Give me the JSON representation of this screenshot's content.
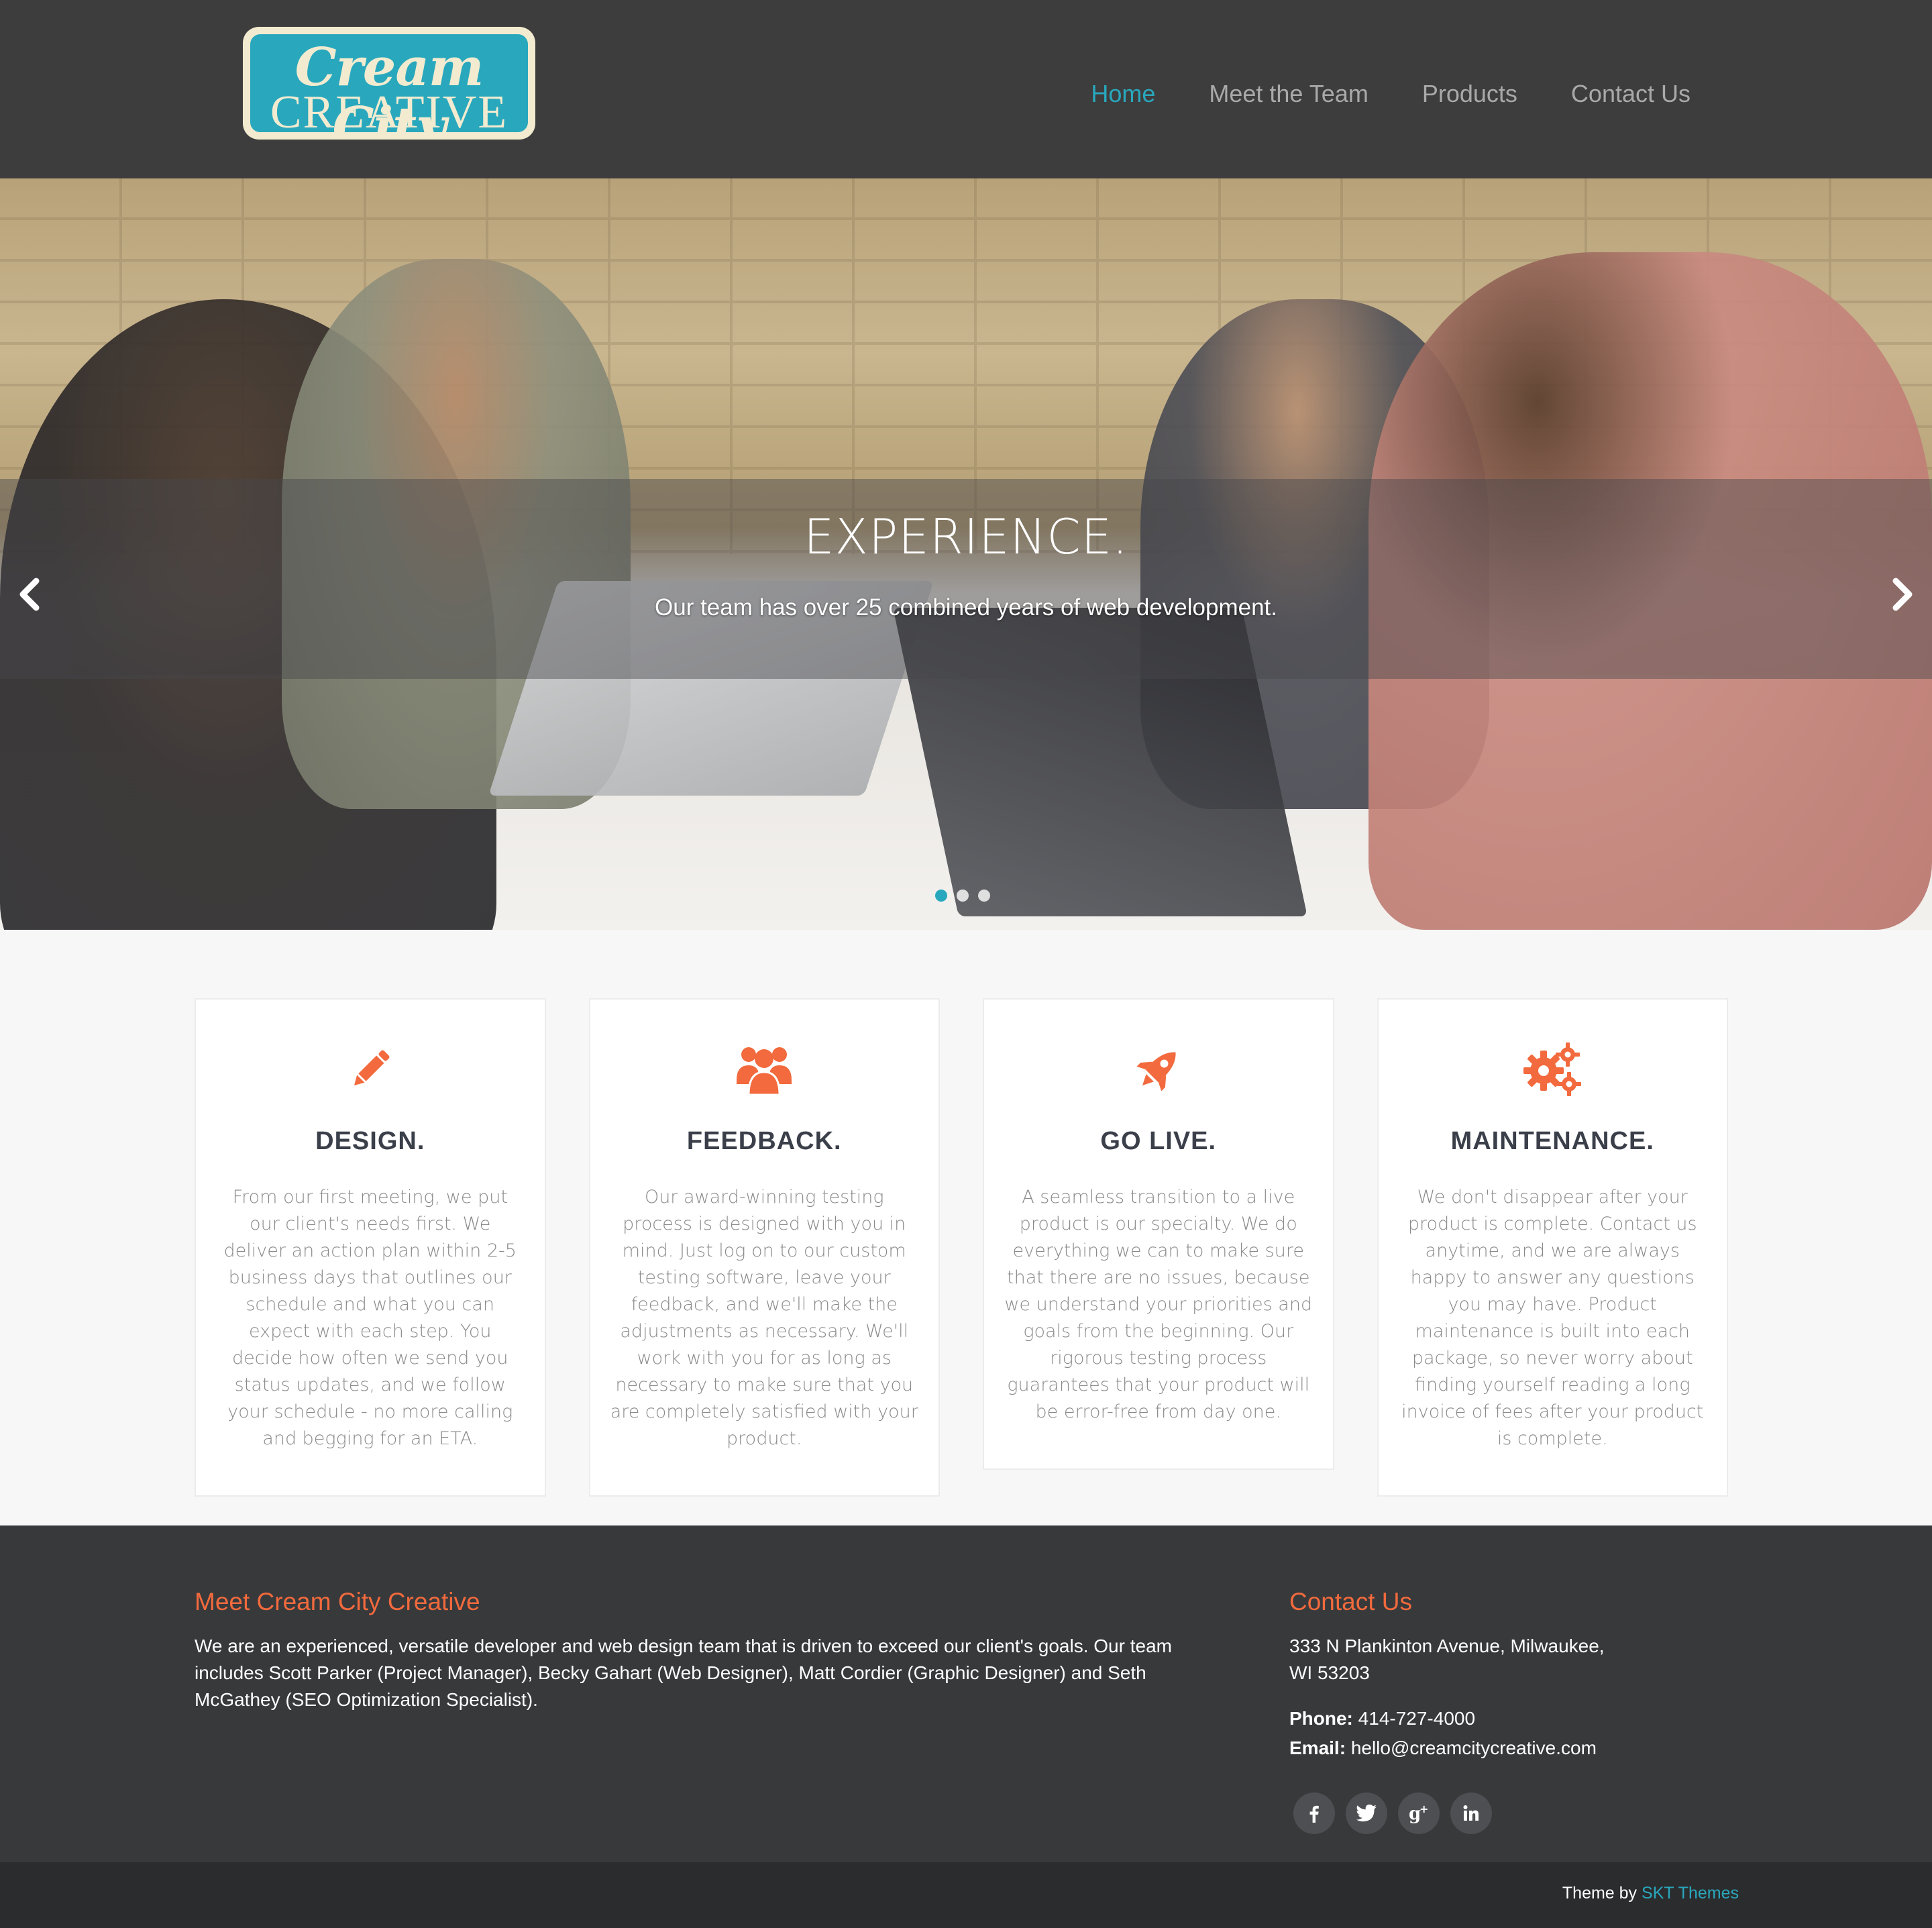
{
  "header": {
    "logo": {
      "line1": "Cream City",
      "line2": "CREATIVE"
    },
    "nav": [
      {
        "label": "Home",
        "active": true
      },
      {
        "label": "Meet the Team",
        "active": false
      },
      {
        "label": "Products",
        "active": false
      },
      {
        "label": "Contact Us",
        "active": false
      }
    ]
  },
  "hero": {
    "title": "EXPERIENCE.",
    "subtitle": "Our team has over 25 combined years of web development.",
    "prev_icon": "chevron-left-icon",
    "next_icon": "chevron-right-icon",
    "slides_count": 3,
    "active_slide": 1
  },
  "features": [
    {
      "icon": "pencil-icon",
      "title": "DESIGN.",
      "text": "From our first meeting, we put our client's needs first. We deliver an action plan within 2-5 business days that outlines our schedule and what you can expect with each step. You decide how often we send you status updates, and we follow your schedule - no more calling and begging for an ETA."
    },
    {
      "icon": "users-icon",
      "title": "FEEDBACK.",
      "text": "Our award-winning testing process is designed with you in mind. Just log on to our custom testing software, leave your feedback, and we'll make the adjustments as necessary. We'll work with you for as long as necessary to make sure that you are completely satisfied with your product."
    },
    {
      "icon": "rocket-icon",
      "title": "GO LIVE.",
      "text": "A seamless transition to a live product is our specialty. We do everything we can to make sure that there are no issues, because we understand your priorities and goals from the beginning. Our rigorous testing process guarantees that your product will be error-free from day one."
    },
    {
      "icon": "gears-icon",
      "title": "MAINTENANCE.",
      "text": "We don't disappear after your product is complete. Contact us anytime, and we are always happy to answer any questions you may have. Product maintenance is built into each package, so never worry about finding yourself reading a long invoice of fees after your product is complete."
    }
  ],
  "footer": {
    "about": {
      "heading": "Meet Cream City Creative",
      "text": "We are an experienced, versatile developer and web design team that is driven to exceed our client's goals. Our team includes Scott Parker (Project Manager), Becky Gahart (Web Designer), Matt Cordier (Graphic Designer) and Seth McGathey (SEO Optimization Specialist)."
    },
    "contact": {
      "heading": "Contact Us",
      "address_line1": "333 N Plankinton Avenue, Milwaukee,",
      "address_line2": "WI 53203",
      "phone_label": "Phone:",
      "phone": "414-727-4000",
      "email_label": "Email:",
      "email": "hello@creamcitycreative.com"
    },
    "socials": [
      {
        "name": "facebook-icon",
        "glyph": "f"
      },
      {
        "name": "twitter-icon",
        "glyph": "t"
      },
      {
        "name": "google-plus-icon",
        "glyph": "g+"
      },
      {
        "name": "linkedin-icon",
        "glyph": "in"
      }
    ],
    "credit_prefix": "Theme by",
    "credit_link": "SKT Themes"
  },
  "colors": {
    "accent": "#29a8bd",
    "orange": "#f26a3d",
    "header_bg": "#3d3d3e",
    "footer_bg": "#38393b"
  }
}
